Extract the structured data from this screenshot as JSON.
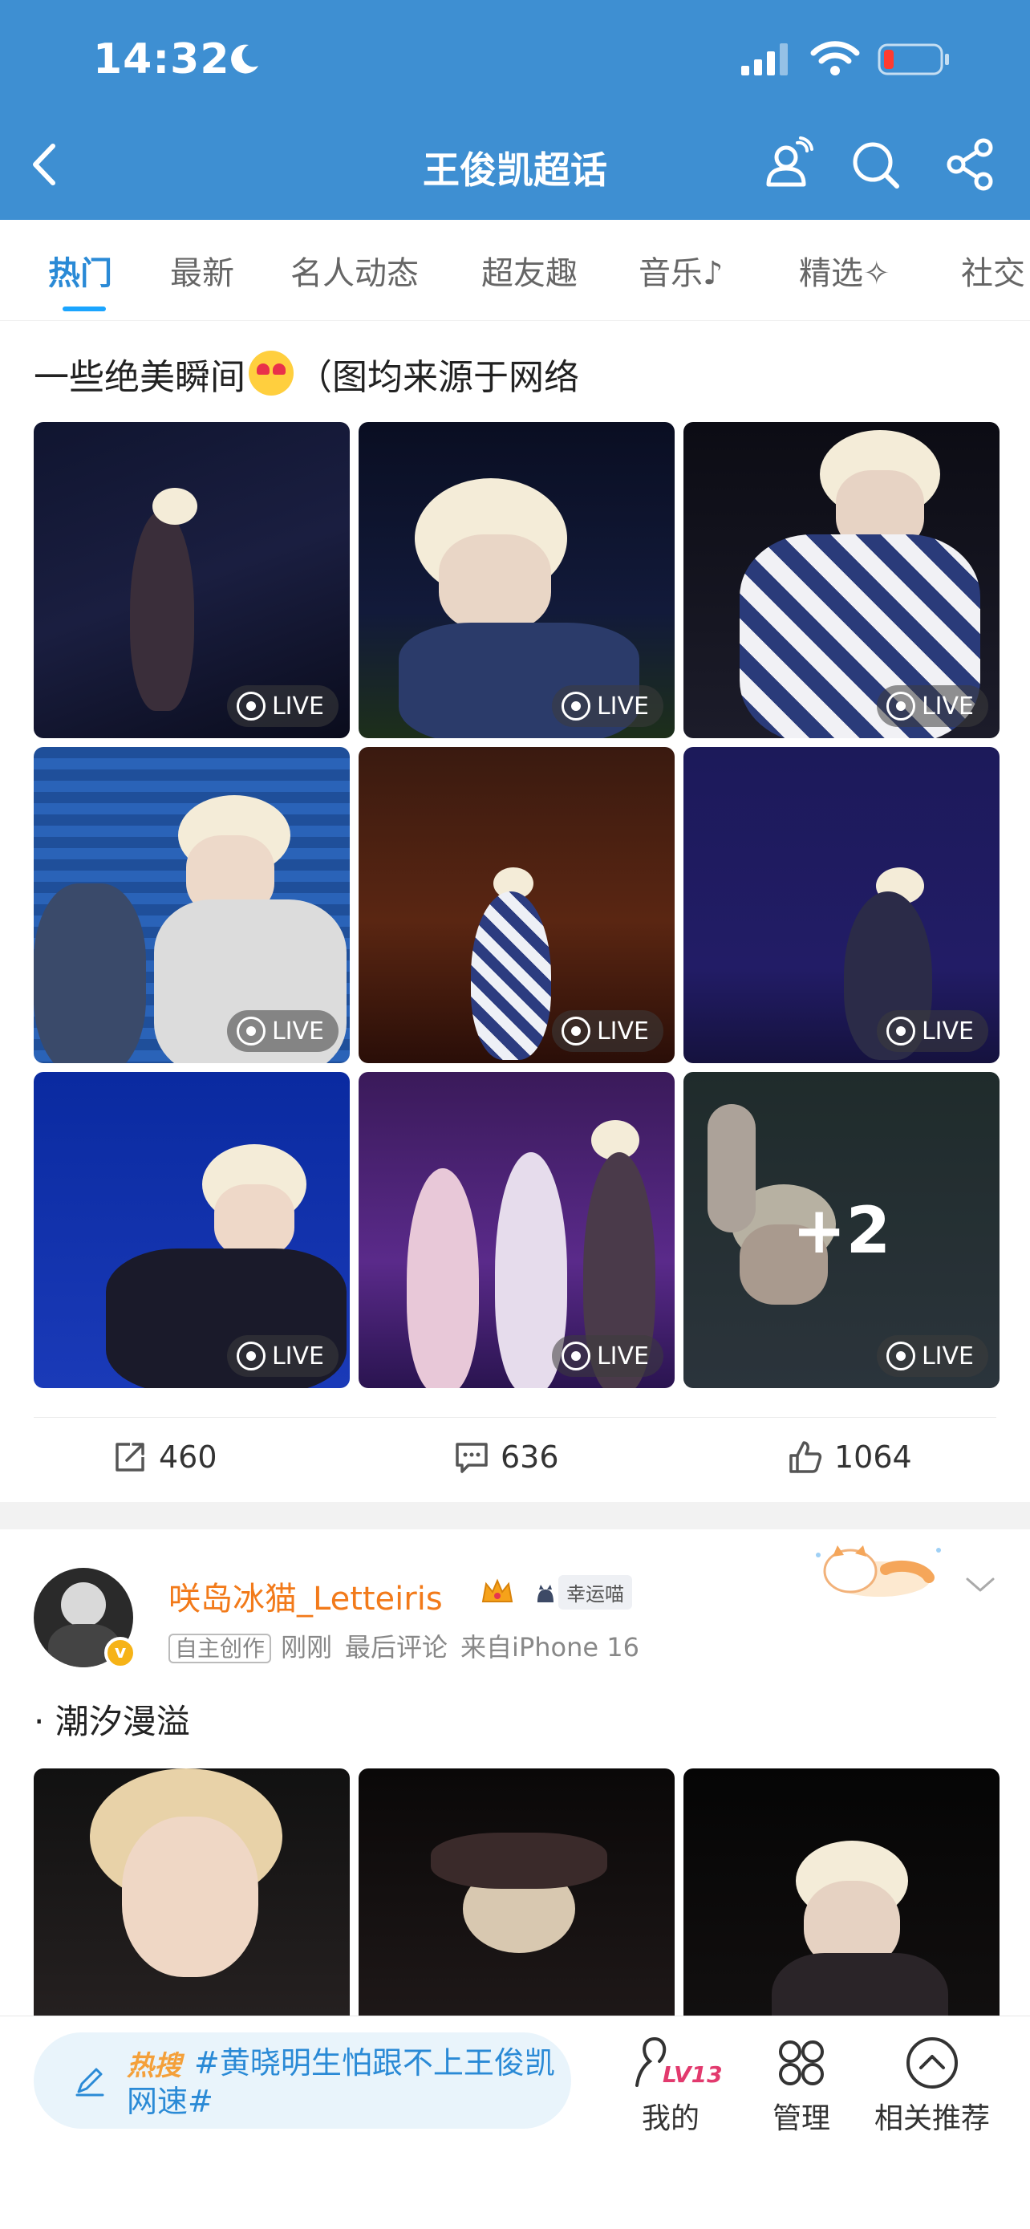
{
  "status_bar": {
    "time": "14:32"
  },
  "header": {
    "title": "王俊凯超话"
  },
  "tabs": [
    "热门",
    "最新",
    "名人动态",
    "超友趣",
    "音乐",
    "精选",
    "社交"
  ],
  "post1": {
    "title_before": "一些绝美瞬间",
    "title_after": "（图均来源于网络",
    "live_label": "LIVE",
    "more_count": "+2",
    "actions": {
      "share_count": "460",
      "comment_count": "636",
      "like_count": "1064"
    }
  },
  "post2": {
    "username": "咲岛冰猫_Letteiris",
    "badge_label": "幸运喵",
    "tag": "自主创作",
    "time": "刚刚",
    "last_comment": "最后评论",
    "source": "来自iPhone 16",
    "text": "· 潮汐漫溢"
  },
  "bottom_bar": {
    "hot_label": "热搜",
    "hot_text": "#黄晓明生怕跟不上王俊凯网速#",
    "level": "LV13",
    "mine_label": "我的",
    "manage_label": "管理",
    "recommend_label": "相关推荐"
  },
  "colors": {
    "header_bg": "#3e8fd2",
    "tab_active": "#2a8ad6",
    "username": "#f27a1a",
    "hot_label": "#f4a03a",
    "level": "#e23a6e"
  }
}
